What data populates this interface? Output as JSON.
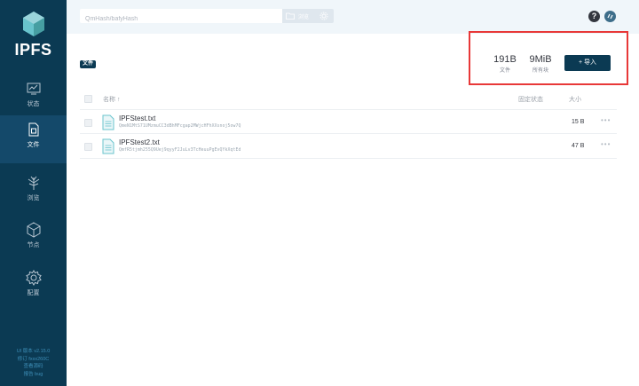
{
  "sidebar": {
    "logo_text": "IPFS",
    "items": [
      {
        "label": "状态",
        "icon": "status-monitor-icon"
      },
      {
        "label": "文件",
        "icon": "files-icon",
        "active": true
      },
      {
        "label": "浏览",
        "icon": "explore-tree-icon"
      },
      {
        "label": "节点",
        "icon": "peers-cube-icon"
      },
      {
        "label": "配置",
        "icon": "settings-gear-icon"
      }
    ],
    "footer": [
      "UI 版本 v2.15.0",
      "修订 fxxx260C",
      "查看源码",
      "报告 bug"
    ]
  },
  "header": {
    "search_placeholder": "QmHash/bafyHash",
    "browse_label": "浏览",
    "help_icon": "help-icon",
    "connect_icon": "connection-icon"
  },
  "breadcrumb": "文件",
  "stats": {
    "files_value": "191B",
    "files_label": "文件",
    "blocks_value": "9MiB",
    "blocks_label": "所有块",
    "import_label": "+ 导入"
  },
  "table": {
    "headers": {
      "name": "名称 ↑",
      "pin_status": "固定状态",
      "size": "大小"
    },
    "rows": [
      {
        "name": "IPFStest.txt",
        "hash": "QmeN1MtS71UMzmuCC3dBhMFcgap2MWjcHFhXXsnoj5ow7Q",
        "size": "15 B"
      },
      {
        "name": "IPFStest2.txt",
        "hash": "QmfR5tjmh255Q9Uej9qyyF2JuLv3TcHeuuPgEvQYkXqtEd",
        "size": "47 B"
      }
    ]
  },
  "colors": {
    "sidebar": "#0b3a53",
    "accent": "#0b3a53",
    "highlight": "#e83838"
  }
}
